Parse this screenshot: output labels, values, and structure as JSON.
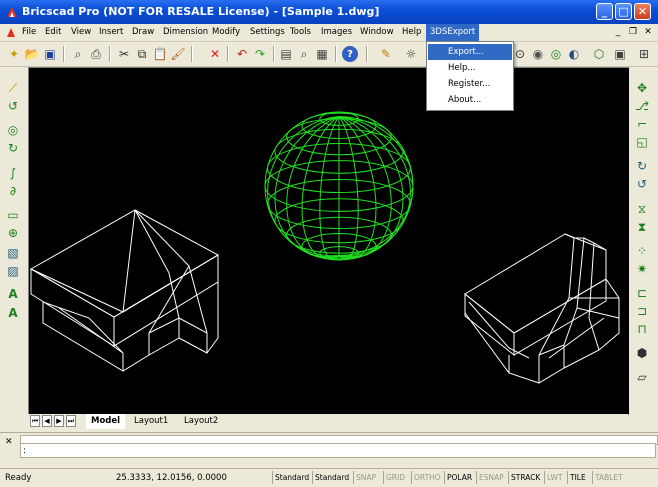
{
  "window": {
    "title": "Bricscad Pro (NOT FOR RESALE License) - [Sample 1.dwg]",
    "minimize": "_",
    "maximize": "□",
    "close": "✕"
  },
  "menu": {
    "items": [
      "File",
      "Edit",
      "View",
      "Insert",
      "Draw",
      "Dimension",
      "Modify",
      "Settings",
      "Tools",
      "Images",
      "Window",
      "Help",
      "3DSExport"
    ],
    "active": "3DSExport",
    "mdi_min": "_",
    "mdi_restore": "❐",
    "mdi_close": "✕"
  },
  "dropdown": {
    "items": [
      "Export...",
      "Help...",
      "Register...",
      "About..."
    ],
    "highlighted": "Export..."
  },
  "layout_tabs": {
    "nav": [
      "⏮",
      "◀",
      "▶",
      "⏭"
    ],
    "tabs": [
      "Model",
      "Layout1",
      "Layout2"
    ],
    "active": "Model"
  },
  "command": {
    "prompt": ":",
    "close": "✕"
  },
  "status": {
    "ready": "Ready",
    "coords": "25.3333, 12.0156, 0.0000",
    "buttons": [
      {
        "label": "Standard",
        "on": true
      },
      {
        "label": "Standard",
        "on": true
      },
      {
        "label": "SNAP",
        "on": false
      },
      {
        "label": "GRID",
        "on": false
      },
      {
        "label": "ORTHO",
        "on": false
      },
      {
        "label": "POLAR",
        "on": true
      },
      {
        "label": "ESNAP",
        "on": false
      },
      {
        "label": "STRACK",
        "on": true
      },
      {
        "label": "LWT",
        "on": false
      },
      {
        "label": "TILE",
        "on": true
      },
      {
        "label": "TABLET",
        "on": false
      }
    ]
  },
  "colors": {
    "titlebar": "#0a4fd6",
    "sphere": "#21e021",
    "wire": "#ffffff",
    "highlight": "#316ac5"
  }
}
